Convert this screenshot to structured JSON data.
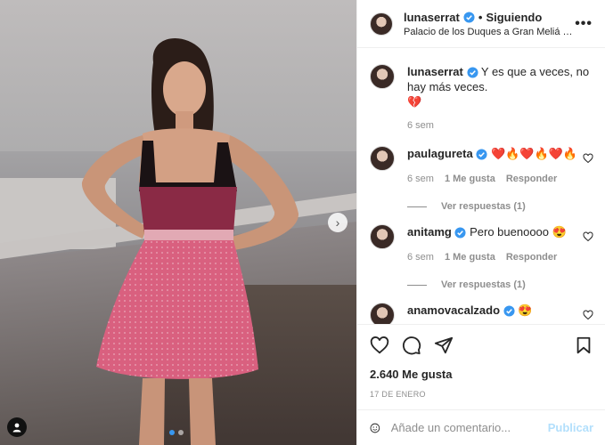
{
  "post": {
    "username": "lunaserrat",
    "follow_status": "Siguiendo",
    "location": "Palacio de los Duques a Gran Meliá …",
    "caption_text": "Y es que a veces, no hay más veces.",
    "caption_emoji": "💔",
    "caption_time": "6 sem",
    "likes": "2.640 Me gusta",
    "date": "17 DE ENERO"
  },
  "comments": [
    {
      "username": "paulagureta",
      "text": "❤️🔥❤️🔥❤️🔥",
      "time": "6 sem",
      "likes": "1 Me gusta",
      "reply": "Responder",
      "replies": "Ver respuestas (1)"
    },
    {
      "username": "anitamg",
      "text": "Pero buenoooo 😍",
      "time": "6 sem",
      "likes": "1 Me gusta",
      "reply": "Responder",
      "replies": "Ver respuestas (1)"
    },
    {
      "username": "anamovacalzado",
      "text": "😍"
    }
  ],
  "composer": {
    "placeholder": "Añade un comentario...",
    "publish": "Publicar"
  },
  "icons": {
    "more": "more-options-icon",
    "like": "heart-icon",
    "comment": "comment-icon",
    "share": "send-icon",
    "save": "bookmark-icon",
    "emoji": "emoji-icon",
    "verified": "verified-badge-icon"
  },
  "colors": {
    "verified": "#3897f0",
    "publish_disabled": "#b2dffc",
    "muted": "#8e8e8e"
  }
}
